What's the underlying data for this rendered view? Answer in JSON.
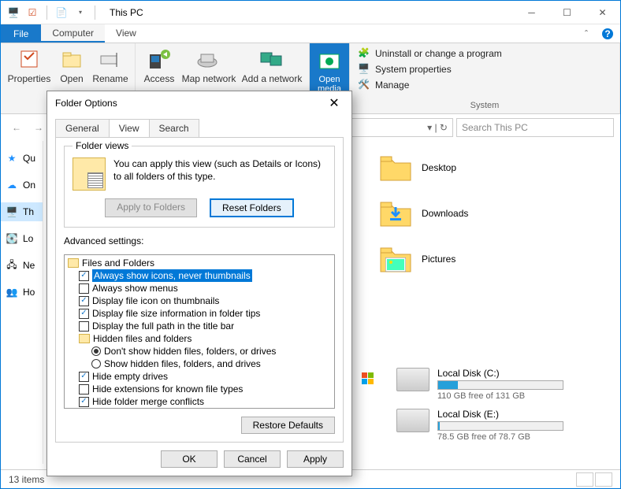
{
  "titlebar": {
    "title": "This PC"
  },
  "menutabs": {
    "file": "File",
    "computer": "Computer",
    "view": "View"
  },
  "ribbon": {
    "properties": "Properties",
    "open": "Open",
    "rename": "Rename",
    "access": "Access",
    "map_network": "Map network",
    "add_network": "Add a network",
    "open_media": "Open\nmedia",
    "uninstall": "Uninstall or change a program",
    "sysprops": "System properties",
    "manage": "Manage",
    "group_system": "System"
  },
  "search": {
    "placeholder": "Search This PC"
  },
  "sidebar": {
    "items": [
      {
        "label": "Qu"
      },
      {
        "label": "On"
      },
      {
        "label": "Th"
      },
      {
        "label": "Lo"
      },
      {
        "label": "Ne"
      },
      {
        "label": "Ho"
      }
    ]
  },
  "content": {
    "folders": [
      {
        "name": "Desktop",
        "overlay": null
      },
      {
        "name": "Downloads",
        "overlay": "download"
      },
      {
        "name": "Pictures",
        "overlay": "picture"
      }
    ],
    "disks": [
      {
        "name": "Local Disk (C:)",
        "free_text": "110 GB free of 131 GB",
        "fill_pct": 16
      },
      {
        "name": "Local Disk (E:)",
        "free_text": "78.5 GB free of 78.7 GB",
        "fill_pct": 1
      }
    ]
  },
  "statusbar": {
    "items": "13 items"
  },
  "dialog": {
    "title": "Folder Options",
    "tabs": {
      "general": "General",
      "view": "View",
      "search": "Search"
    },
    "folder_views": {
      "legend": "Folder views",
      "desc": "You can apply this view (such as Details or Icons) to all folders of this type.",
      "apply": "Apply to Folders",
      "reset": "Reset Folders"
    },
    "advanced_label": "Advanced settings:",
    "tree": {
      "root": "Files and Folders",
      "items": [
        {
          "type": "check",
          "checked": true,
          "selected": true,
          "label": "Always show icons, never thumbnails"
        },
        {
          "type": "check",
          "checked": false,
          "label": "Always show menus"
        },
        {
          "type": "check",
          "checked": true,
          "label": "Display file icon on thumbnails"
        },
        {
          "type": "check",
          "checked": true,
          "label": "Display file size information in folder tips"
        },
        {
          "type": "check",
          "checked": false,
          "label": "Display the full path in the title bar"
        },
        {
          "type": "folder",
          "label": "Hidden files and folders"
        },
        {
          "type": "radio",
          "checked": true,
          "indent": 2,
          "label": "Don't show hidden files, folders, or drives"
        },
        {
          "type": "radio",
          "checked": false,
          "indent": 2,
          "label": "Show hidden files, folders, and drives"
        },
        {
          "type": "check",
          "checked": true,
          "label": "Hide empty drives"
        },
        {
          "type": "check",
          "checked": false,
          "label": "Hide extensions for known file types"
        },
        {
          "type": "check",
          "checked": true,
          "label": "Hide folder merge conflicts"
        }
      ]
    },
    "restore": "Restore Defaults",
    "ok": "OK",
    "cancel": "Cancel",
    "apply": "Apply"
  }
}
